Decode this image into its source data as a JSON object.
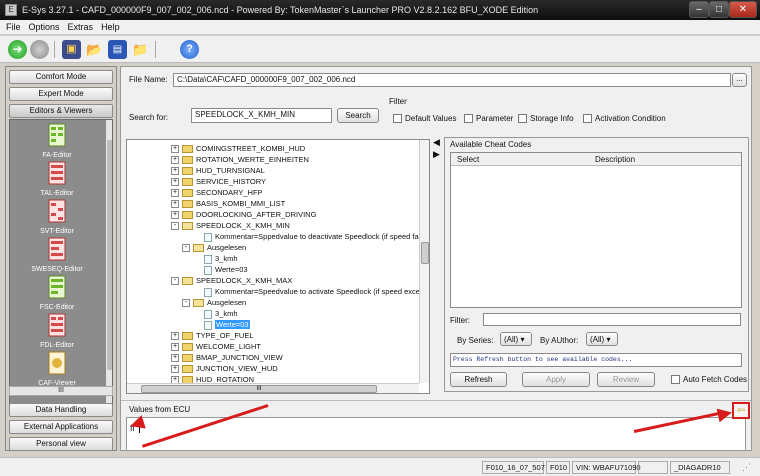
{
  "window": {
    "title": "E-Sys 3.27.1 - CAFD_000000F9_007_002_006.ncd - Powered By: TokenMaster`s Launcher PRO V2.8.2.162 BFU_XODE Edition",
    "icon_label": "E"
  },
  "menu": [
    "File",
    "Options",
    "Extras",
    "Help"
  ],
  "toolbar_icons": [
    "go-icon",
    "stop-icon",
    "save-all-icon",
    "open-folder-icon",
    "save-icon",
    "open-file-icon",
    "help-icon"
  ],
  "leftnav": {
    "comfort": "Comfort Mode",
    "expert": "Expert Mode",
    "editors": "Editors & Viewers",
    "items": [
      "FA-Editor",
      "TAL-Editor",
      "SVT-Editor",
      "SWESEQ-Editor",
      "FSC-Editor",
      "FDL-Editor",
      "CAF-Viewer"
    ],
    "scroll_label": "III",
    "data_handling": "Data Handling",
    "external": "External Applications",
    "personal": "Personal view"
  },
  "file": {
    "label": "File Name:",
    "value": "C:\\Data\\CAF\\CAFD_000000F9_007_002_006.ncd",
    "browse": "..."
  },
  "search": {
    "label": "Search for:",
    "value": "SPEEDLOCK_X_KMH_MIN",
    "button": "Search"
  },
  "filter": {
    "title": "Filter",
    "options": [
      "Default Values",
      "Parameter",
      "Storage Info",
      "Activation Condition"
    ]
  },
  "tree": {
    "rows": [
      {
        "indent": 1,
        "type": "folder",
        "exp": "+",
        "text": "COMINGSTREET_KOMBI_HUD"
      },
      {
        "indent": 1,
        "type": "folder",
        "exp": "+",
        "text": "ROTATION_WERTE_EINHEITEN"
      },
      {
        "indent": 1,
        "type": "folder",
        "exp": "+",
        "text": "HUD_TURNSIGNAL"
      },
      {
        "indent": 1,
        "type": "folder",
        "exp": "+",
        "text": "SERVICE_HISTORY"
      },
      {
        "indent": 1,
        "type": "folder",
        "exp": "+",
        "text": "SECONDARY_HFP"
      },
      {
        "indent": 1,
        "type": "folder",
        "exp": "+",
        "text": "BASIS_KOMBI_MMI_LIST"
      },
      {
        "indent": 1,
        "type": "folder",
        "exp": "+",
        "text": "DOORLOCKING_AFTER_DRIVING"
      },
      {
        "indent": 1,
        "type": "folder-open",
        "exp": "-",
        "text": "SPEEDLOCK_X_KMH_MIN"
      },
      {
        "indent": 3,
        "type": "doc",
        "exp": "",
        "text": "Kommentar=Sppedvalue to deactivate Speedlock (if speed falls below this value)"
      },
      {
        "indent": 2,
        "type": "folder-open",
        "exp": "-",
        "text": "Ausgelesen"
      },
      {
        "indent": 3,
        "type": "doc",
        "exp": "",
        "text": "3_kmh"
      },
      {
        "indent": 3,
        "type": "doc",
        "exp": "",
        "text": "Werte=03"
      },
      {
        "indent": 1,
        "type": "folder-open",
        "exp": "-",
        "text": "SPEEDLOCK_X_KMH_MAX"
      },
      {
        "indent": 3,
        "type": "doc",
        "exp": "",
        "text": "Kommentar=Speedvalue to activate Speedlock (if speed exceeds this value)"
      },
      {
        "indent": 2,
        "type": "folder-open",
        "exp": "-",
        "text": "Ausgelesen"
      },
      {
        "indent": 3,
        "type": "doc",
        "exp": "",
        "text": "3_kmh"
      },
      {
        "indent": 3,
        "type": "doc",
        "exp": "",
        "text": "Werte=03",
        "selected": true
      },
      {
        "indent": 1,
        "type": "folder",
        "exp": "+",
        "text": "TYPE_OF_FUEL"
      },
      {
        "indent": 1,
        "type": "folder",
        "exp": "+",
        "text": "WELCOME_LIGHT"
      },
      {
        "indent": 1,
        "type": "folder",
        "exp": "+",
        "text": "BMAP_JUNCTION_VIEW"
      },
      {
        "indent": 1,
        "type": "folder",
        "exp": "+",
        "text": "JUNCTION_VIEW_HUD"
      },
      {
        "indent": 1,
        "type": "folder",
        "exp": "+",
        "text": "HUD_ROTATION"
      }
    ],
    "hscroll_label": "III"
  },
  "cheat": {
    "title": "Available Cheat Codes",
    "col_select": "Select",
    "col_desc": "Description",
    "filter_label": "Filter:",
    "series_label": "By Series:",
    "series_value": "(All)",
    "author_label": "By AUthor:",
    "author_value": "(All)",
    "hint": "Press Refresh button to see available codes...",
    "refresh": "Refresh",
    "apply": "Apply",
    "review": "Review",
    "auto_fetch": "Auto Fetch Codes"
  },
  "ecu": {
    "label": "Values from ECU",
    "value": "ff"
  },
  "status": [
    "F010_16_07_507",
    "F010",
    "VIN: WBAFU71090",
    "",
    "_DIAGADR10"
  ],
  "colors": {
    "arrow": "#d81c1c",
    "selection": "#3399ff"
  }
}
